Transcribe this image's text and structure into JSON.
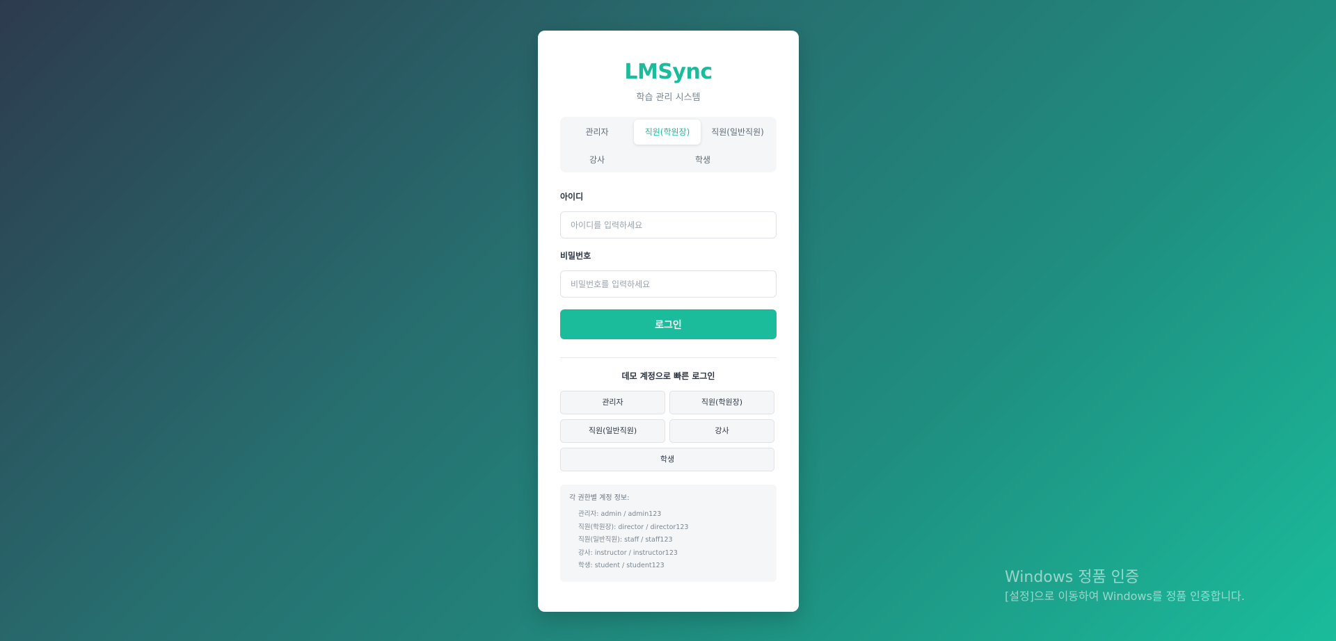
{
  "brand": {
    "name": "LMSync",
    "subtitle": "학습 관리 시스템"
  },
  "role_tabs": [
    {
      "label": "관리자",
      "active": false
    },
    {
      "label": "직원(학원장)",
      "active": true
    },
    {
      "label": "직원(일반직원)",
      "active": false
    },
    {
      "label": "강사",
      "active": false
    },
    {
      "label": "학생",
      "active": false
    }
  ],
  "form": {
    "id_label": "아이디",
    "id_placeholder": "아이디를 입력하세요",
    "id_value": "",
    "password_label": "비밀번호",
    "password_placeholder": "비밀번호를 입력하세요",
    "password_value": "",
    "login_label": "로그인"
  },
  "demo": {
    "title": "데모 계정으로 빠른 로그인",
    "buttons": [
      "관리자",
      "직원(학원장)",
      "직원(일반직원)",
      "강사",
      "학생"
    ]
  },
  "accounts_info": {
    "title": "각 권한별 계정 정보:",
    "lines": [
      "관리자: admin / admin123",
      "직원(학원장): director / director123",
      "직원(일반직원): staff / staff123",
      "강사: instructor / instructor123",
      "학생: student / student123"
    ]
  },
  "watermark": {
    "title": "Windows 정품 인증",
    "subtitle": "[설정]으로 이동하여 Windows를 정품 인증합니다."
  },
  "colors": {
    "accent": "#1abc9c",
    "background_start": "#2d3b4e",
    "background_end": "#1abc9c"
  }
}
